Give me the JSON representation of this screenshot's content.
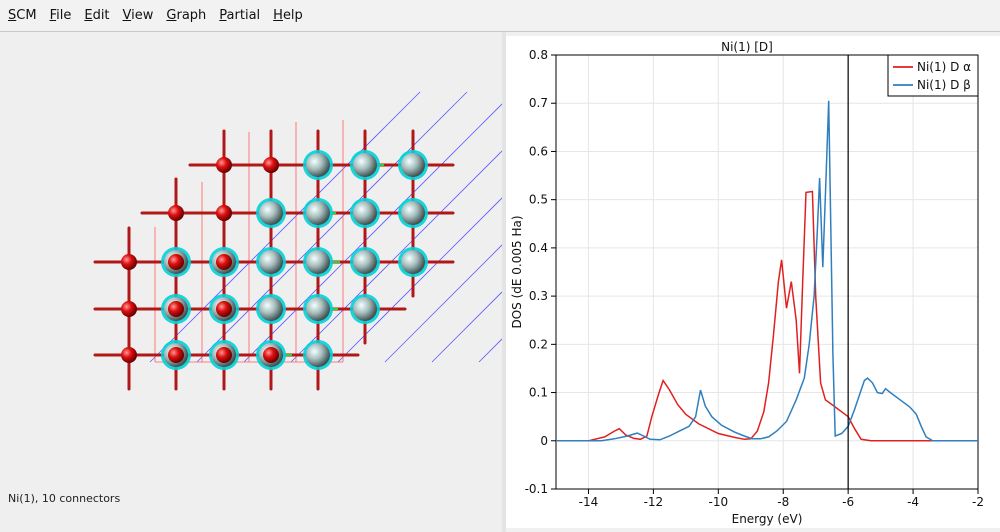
{
  "menu": {
    "items": [
      {
        "label": "SCM",
        "mnemonic": "S",
        "rest": "CM"
      },
      {
        "label": "File",
        "mnemonic": "F",
        "rest": "ile"
      },
      {
        "label": "Edit",
        "mnemonic": "E",
        "rest": "dit"
      },
      {
        "label": "View",
        "mnemonic": "V",
        "rest": "iew"
      },
      {
        "label": "Graph",
        "mnemonic": "G",
        "rest": "raph"
      },
      {
        "label": "Partial",
        "mnemonic": "P",
        "rest": "artial"
      },
      {
        "label": "Help",
        "mnemonic": "H",
        "rest": "elp"
      }
    ]
  },
  "status": {
    "text": "Ni(1), 10 connectors"
  },
  "molecule": {
    "description_colors": {
      "oxygen": "#e01010",
      "nickel": "#a8bdbd",
      "nickel_highlight": "#00d0d8",
      "bond": "#b01818",
      "cell": "#5a5aff"
    }
  },
  "chart_data": {
    "type": "line",
    "title": "Ni(1) [D]",
    "xlabel": "Energy (eV)",
    "ylabel": "DOS (dE 0.005 Ha)",
    "xlim": [
      -15,
      -2
    ],
    "ylim": [
      -0.1,
      0.8
    ],
    "xticks": [
      -14,
      -12,
      -10,
      -8,
      -6,
      -4,
      -2
    ],
    "yticks": [
      -0.1,
      0,
      0.1,
      0.2,
      0.3,
      0.4,
      0.5,
      0.6,
      0.7,
      0.8
    ],
    "ytick_labels": [
      "-0.1",
      "0",
      "0.1",
      "0.2",
      "0.3",
      "0.4",
      "0.5",
      "0.6",
      "0.7",
      "0.8"
    ],
    "grid": true,
    "legend_position": "top-right",
    "vline_x": -6.0,
    "series": [
      {
        "name": "Ni(1) D α",
        "color": "#e02020",
        "points": [
          [
            -15,
            0
          ],
          [
            -14,
            0
          ],
          [
            -13.5,
            0.008
          ],
          [
            -13.2,
            0.02
          ],
          [
            -13.05,
            0.025
          ],
          [
            -12.85,
            0.012
          ],
          [
            -12.6,
            0.005
          ],
          [
            -12.4,
            0.003
          ],
          [
            -12.2,
            0.01
          ],
          [
            -12.05,
            0.05
          ],
          [
            -11.85,
            0.095
          ],
          [
            -11.7,
            0.125
          ],
          [
            -11.5,
            0.105
          ],
          [
            -11.25,
            0.075
          ],
          [
            -11.0,
            0.055
          ],
          [
            -10.6,
            0.035
          ],
          [
            -10.0,
            0.015
          ],
          [
            -9.5,
            0.007
          ],
          [
            -9.2,
            0.003
          ],
          [
            -9.0,
            0.004
          ],
          [
            -8.8,
            0.02
          ],
          [
            -8.6,
            0.06
          ],
          [
            -8.45,
            0.12
          ],
          [
            -8.3,
            0.22
          ],
          [
            -8.15,
            0.33
          ],
          [
            -8.05,
            0.375
          ],
          [
            -7.9,
            0.275
          ],
          [
            -7.75,
            0.33
          ],
          [
            -7.6,
            0.25
          ],
          [
            -7.5,
            0.14
          ],
          [
            -7.4,
            0.33
          ],
          [
            -7.3,
            0.515
          ],
          [
            -7.1,
            0.517
          ],
          [
            -7.0,
            0.3
          ],
          [
            -6.85,
            0.12
          ],
          [
            -6.7,
            0.085
          ],
          [
            -6.4,
            0.07
          ],
          [
            -6.0,
            0.05
          ],
          [
            -5.8,
            0.025
          ],
          [
            -5.6,
            0.003
          ],
          [
            -5.3,
            0
          ],
          [
            -2,
            0
          ]
        ]
      },
      {
        "name": "Ni(1) D β",
        "color": "#2f7fbf",
        "points": [
          [
            -15,
            0
          ],
          [
            -13.6,
            0
          ],
          [
            -13.2,
            0.004
          ],
          [
            -12.8,
            0.01
          ],
          [
            -12.5,
            0.016
          ],
          [
            -12.3,
            0.01
          ],
          [
            -12.1,
            0.003
          ],
          [
            -11.8,
            0.002
          ],
          [
            -11.5,
            0.01
          ],
          [
            -11.2,
            0.02
          ],
          [
            -10.9,
            0.03
          ],
          [
            -10.7,
            0.05
          ],
          [
            -10.55,
            0.105
          ],
          [
            -10.4,
            0.072
          ],
          [
            -10.2,
            0.05
          ],
          [
            -9.9,
            0.032
          ],
          [
            -9.5,
            0.018
          ],
          [
            -9.2,
            0.01
          ],
          [
            -8.95,
            0.004
          ],
          [
            -8.7,
            0.004
          ],
          [
            -8.45,
            0.008
          ],
          [
            -8.2,
            0.02
          ],
          [
            -7.9,
            0.04
          ],
          [
            -7.6,
            0.085
          ],
          [
            -7.35,
            0.13
          ],
          [
            -7.2,
            0.2
          ],
          [
            -7.05,
            0.3
          ],
          [
            -6.95,
            0.435
          ],
          [
            -6.88,
            0.545
          ],
          [
            -6.78,
            0.36
          ],
          [
            -6.68,
            0.55
          ],
          [
            -6.6,
            0.705
          ],
          [
            -6.52,
            0.38
          ],
          [
            -6.47,
            0.18
          ],
          [
            -6.4,
            0.01
          ],
          [
            -6.2,
            0.015
          ],
          [
            -6.0,
            0.03
          ],
          [
            -5.8,
            0.065
          ],
          [
            -5.6,
            0.105
          ],
          [
            -5.5,
            0.125
          ],
          [
            -5.4,
            0.13
          ],
          [
            -5.25,
            0.12
          ],
          [
            -5.1,
            0.1
          ],
          [
            -4.95,
            0.098
          ],
          [
            -4.85,
            0.108
          ],
          [
            -4.7,
            0.1
          ],
          [
            -4.4,
            0.085
          ],
          [
            -4.1,
            0.07
          ],
          [
            -3.9,
            0.055
          ],
          [
            -3.75,
            0.03
          ],
          [
            -3.6,
            0.008
          ],
          [
            -3.4,
            0
          ],
          [
            -2,
            0
          ]
        ]
      }
    ]
  }
}
